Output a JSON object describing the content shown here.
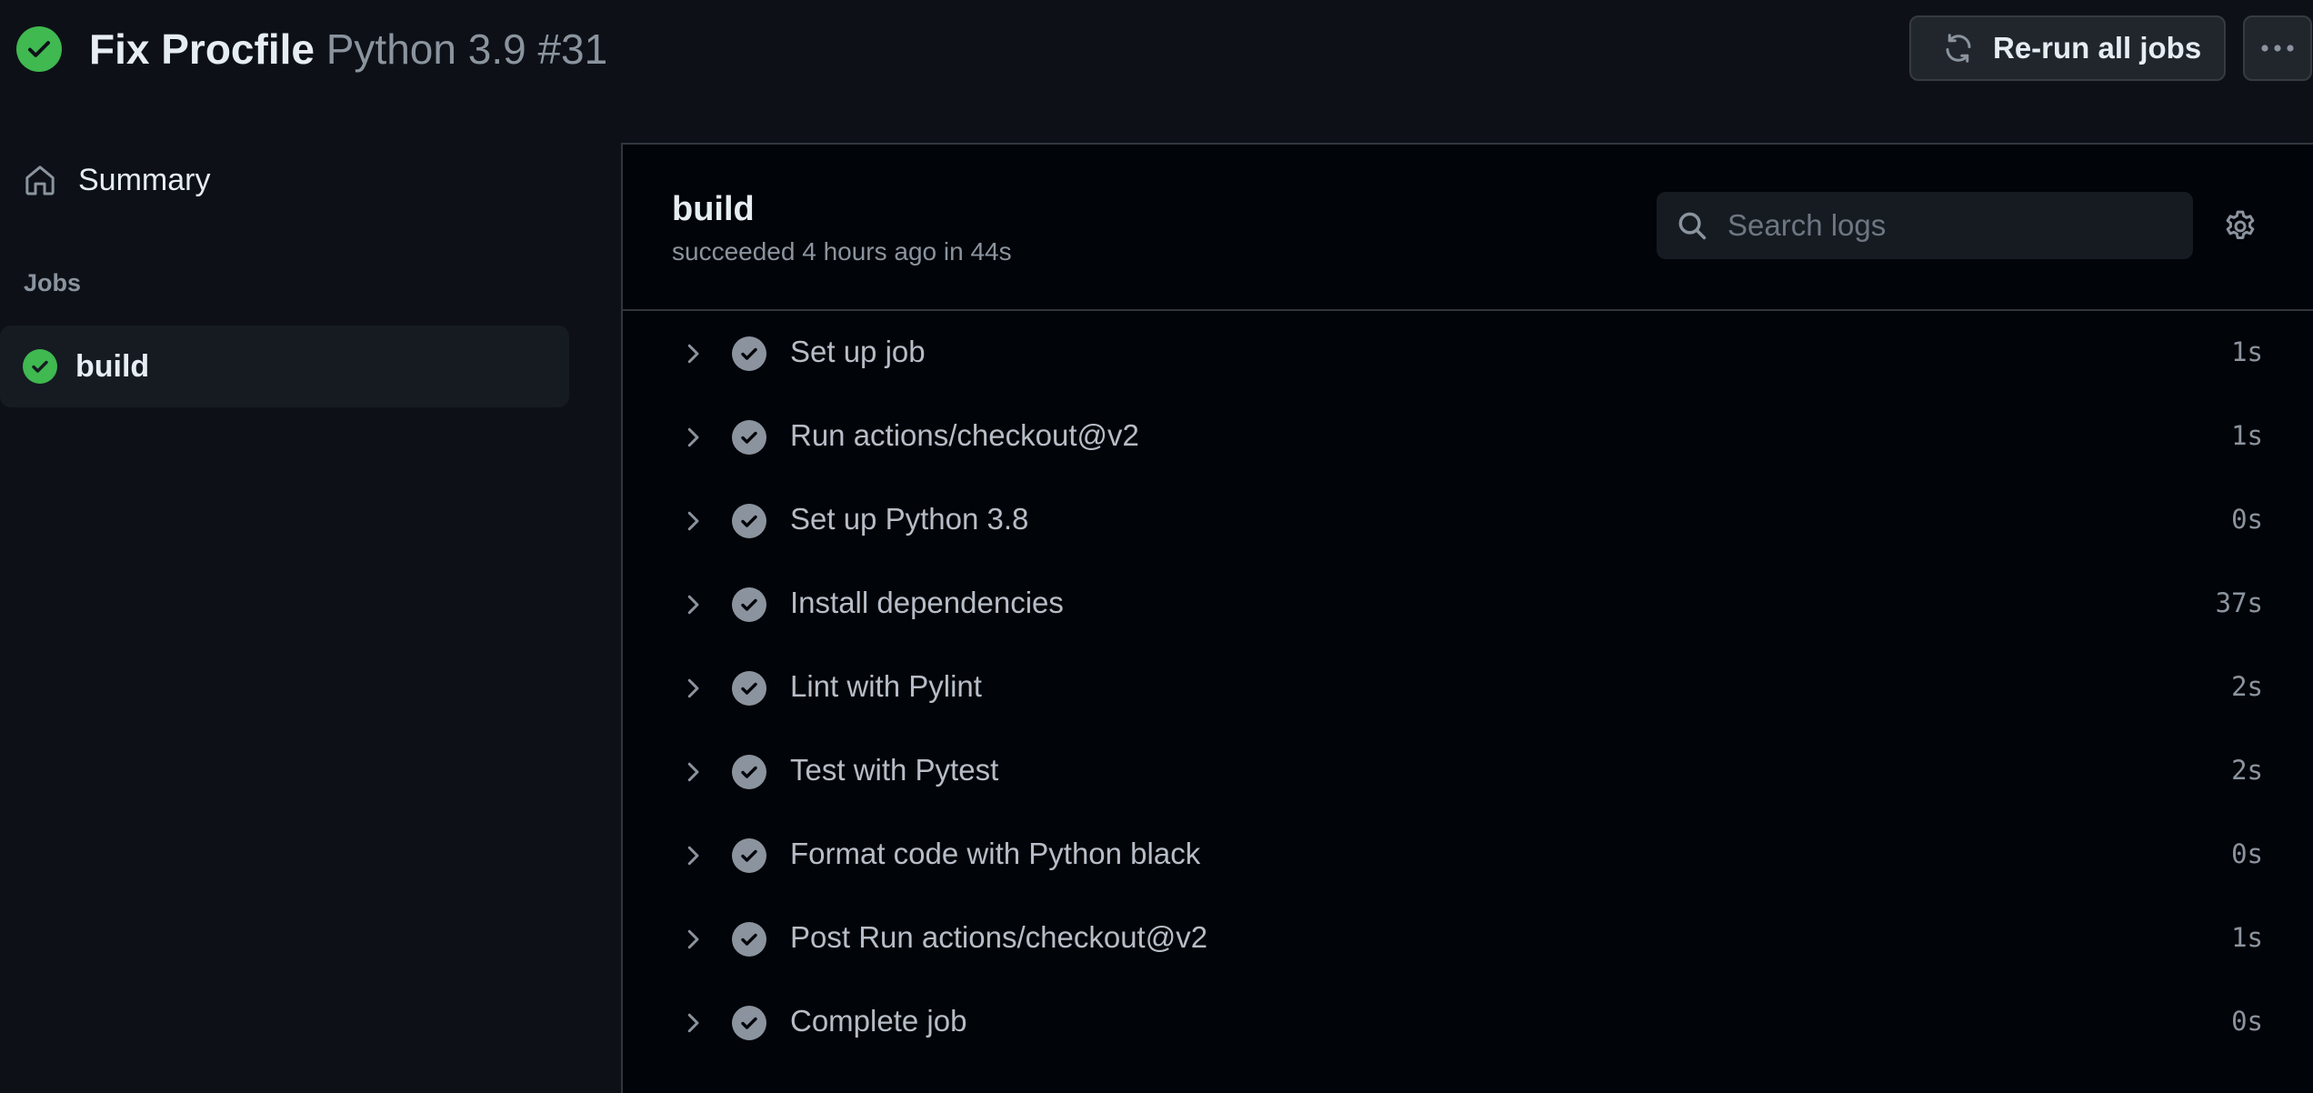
{
  "header": {
    "title_bold": "Fix Procfile",
    "title_muted": "Python 3.9 #31",
    "rerun_label": "Re-run all jobs"
  },
  "sidebar": {
    "summary_label": "Summary",
    "jobs_heading": "Jobs",
    "jobs": [
      {
        "label": "build",
        "status": "success"
      }
    ]
  },
  "job": {
    "title": "build",
    "subtitle": "succeeded 4 hours ago in 44s",
    "search_placeholder": "Search logs"
  },
  "steps": [
    {
      "name": "Set up job",
      "duration": "1s"
    },
    {
      "name": "Run actions/checkout@v2",
      "duration": "1s"
    },
    {
      "name": "Set up Python 3.8",
      "duration": "0s"
    },
    {
      "name": "Install dependencies",
      "duration": "37s"
    },
    {
      "name": "Lint with Pylint",
      "duration": "2s"
    },
    {
      "name": "Test with Pytest",
      "duration": "2s"
    },
    {
      "name": "Format code with Python black",
      "duration": "0s"
    },
    {
      "name": "Post Run actions/checkout@v2",
      "duration": "1s"
    },
    {
      "name": "Complete job",
      "duration": "0s"
    }
  ],
  "colors": {
    "success": "#3fb950",
    "step_check": "#8b949e",
    "background": "#0d1117",
    "panel": "#010409"
  },
  "icons": {
    "status": "check-circle-icon",
    "rerun": "sync-icon",
    "more": "kebab-horizontal-icon",
    "summary": "home-icon",
    "search": "search-icon",
    "settings": "gear-icon",
    "expand": "chevron-right-icon"
  }
}
